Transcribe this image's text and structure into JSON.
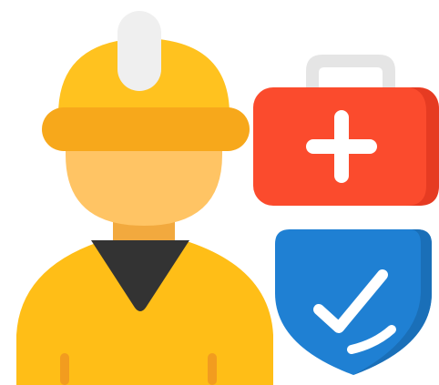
{
  "illustration": {
    "icons": [
      "construction-worker-icon",
      "first-aid-kit-icon",
      "safety-shield-check-icon"
    ],
    "colors": {
      "helmet": "#FFC21F",
      "helmet_brim": "#F7A81B",
      "helmet_stripe": "#EFEFEF",
      "face": "#FFC464",
      "neck_shadow": "#F2A93E",
      "shirt": "#FFBE17",
      "shirt_seam": "#F29C1F",
      "collar": "#333333",
      "kit_body": "#FB4B2D",
      "kit_shade": "#E63B22",
      "kit_handle": "#E5E5E5",
      "kit_cross": "#FFFFFF",
      "shield": "#1F80D3",
      "shield_shade": "#1A6FB8",
      "check": "#FFFFFF"
    }
  }
}
